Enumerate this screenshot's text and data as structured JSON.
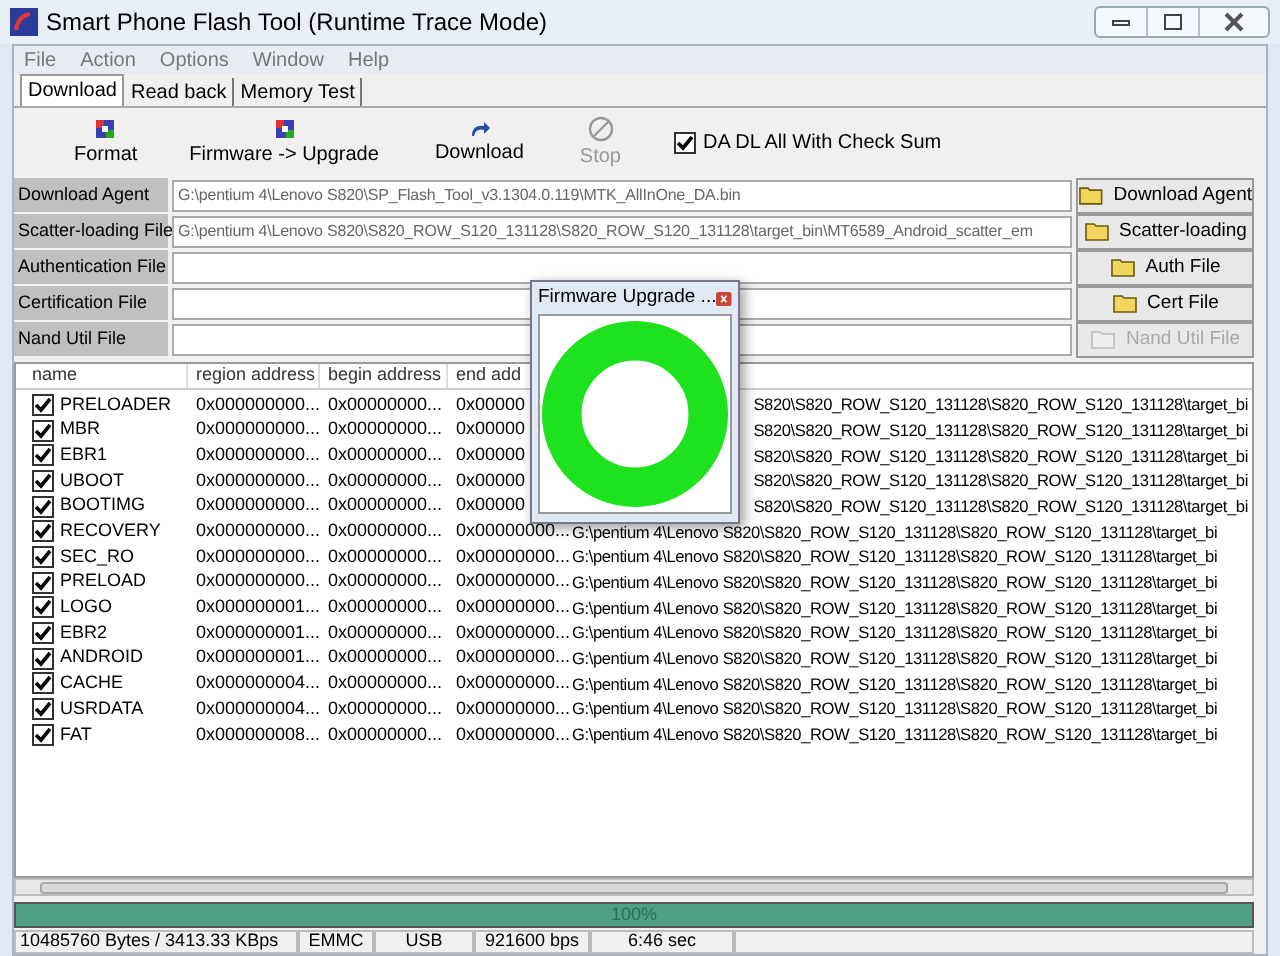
{
  "window": {
    "title": "Smart Phone Flash Tool (Runtime Trace Mode)"
  },
  "menu": [
    "File",
    "Action",
    "Options",
    "Window",
    "Help"
  ],
  "tabs": [
    {
      "label": "Download",
      "selected": true
    },
    {
      "label": "Read back",
      "selected": false
    },
    {
      "label": "Memory Test",
      "selected": false
    }
  ],
  "toolbar": [
    {
      "label": "Format",
      "kind": "format",
      "disabled": false
    },
    {
      "label": "Firmware -> Upgrade",
      "kind": "upgrade",
      "disabled": false
    },
    {
      "label": "Download",
      "kind": "download",
      "disabled": false
    },
    {
      "label": "Stop",
      "kind": "stop",
      "disabled": true
    }
  ],
  "checksum": {
    "label": "DA DL All With Check Sum",
    "checked": true
  },
  "files": [
    {
      "label": "Download Agent",
      "value": "G:\\pentium 4\\Lenovo S820\\SP_Flash_Tool_v3.1304.0.119\\MTK_AllInOne_DA.bin",
      "button": "Download Agent",
      "disabled": false
    },
    {
      "label": "Scatter-loading File",
      "value": "G:\\pentium 4\\Lenovo S820\\S820_ROW_S120_131128\\S820_ROW_S120_131128\\target_bin\\MT6589_Android_scatter_em",
      "button": "Scatter-loading",
      "disabled": false
    },
    {
      "label": "Authentication File",
      "button": "Auth File",
      "disabled": false
    },
    {
      "label": "Certification File",
      "button": "Cert File",
      "disabled": false
    },
    {
      "label": "Nand Util File",
      "button": "Nand Util File",
      "disabled": true
    }
  ],
  "table": {
    "columns": [
      "name",
      "region address",
      "begin address",
      "end add"
    ],
    "rows": [
      {
        "name": "PRELOADER",
        "checked": true,
        "region": "0x000000000...",
        "begin": "0x00000000...",
        "end": "0x00000",
        "location": "S820\\S820_ROW_S120_131128\\S820_ROW_S120_131128\\target_bi"
      },
      {
        "name": "MBR",
        "checked": true,
        "region": "0x000000000...",
        "begin": "0x00000000...",
        "end": "0x00000",
        "location": "S820\\S820_ROW_S120_131128\\S820_ROW_S120_131128\\target_bi"
      },
      {
        "name": "EBR1",
        "checked": true,
        "region": "0x000000000...",
        "begin": "0x00000000...",
        "end": "0x00000",
        "location": "S820\\S820_ROW_S120_131128\\S820_ROW_S120_131128\\target_bi"
      },
      {
        "name": "UBOOT",
        "checked": true,
        "region": "0x000000000...",
        "begin": "0x00000000...",
        "end": "0x00000",
        "location": "S820\\S820_ROW_S120_131128\\S820_ROW_S120_131128\\target_bi"
      },
      {
        "name": "BOOTIMG",
        "checked": true,
        "region": "0x000000000...",
        "begin": "0x00000000...",
        "end": "0x00000",
        "location": "S820\\S820_ROW_S120_131128\\S820_ROW_S120_131128\\target_bi"
      },
      {
        "name": "RECOVERY",
        "checked": true,
        "region": "0x000000000...",
        "begin": "0x00000000...",
        "end": "0x00000000...",
        "location": "G:\\pentium 4\\Lenovo S820\\S820_ROW_S120_131128\\S820_ROW_S120_131128\\target_bi"
      },
      {
        "name": "SEC_RO",
        "checked": true,
        "region": "0x000000000...",
        "begin": "0x00000000...",
        "end": "0x00000000...",
        "location": "G:\\pentium 4\\Lenovo S820\\S820_ROW_S120_131128\\S820_ROW_S120_131128\\target_bi"
      },
      {
        "name": "PRELOAD",
        "checked": true,
        "region": "0x000000000...",
        "begin": "0x00000000...",
        "end": "0x00000000...",
        "location": "G:\\pentium 4\\Lenovo S820\\S820_ROW_S120_131128\\S820_ROW_S120_131128\\target_bi"
      },
      {
        "name": "LOGO",
        "checked": true,
        "region": "0x000000001...",
        "begin": "0x00000000...",
        "end": "0x00000000...",
        "location": "G:\\pentium 4\\Lenovo S820\\S820_ROW_S120_131128\\S820_ROW_S120_131128\\target_bi"
      },
      {
        "name": "EBR2",
        "checked": true,
        "region": "0x000000001...",
        "begin": "0x00000000...",
        "end": "0x00000000...",
        "location": "G:\\pentium 4\\Lenovo S820\\S820_ROW_S120_131128\\S820_ROW_S120_131128\\target_bi"
      },
      {
        "name": "ANDROID",
        "checked": true,
        "region": "0x000000001...",
        "begin": "0x00000000...",
        "end": "0x00000000...",
        "location": "G:\\pentium 4\\Lenovo S820\\S820_ROW_S120_131128\\S820_ROW_S120_131128\\target_bi"
      },
      {
        "name": "CACHE",
        "checked": true,
        "region": "0x000000004...",
        "begin": "0x00000000...",
        "end": "0x00000000...",
        "location": "G:\\pentium 4\\Lenovo S820\\S820_ROW_S120_131128\\S820_ROW_S120_131128\\target_bi"
      },
      {
        "name": "USRDATA",
        "checked": true,
        "region": "0x000000004...",
        "begin": "0x00000000...",
        "end": "0x00000000...",
        "location": "G:\\pentium 4\\Lenovo S820\\S820_ROW_S120_131128\\S820_ROW_S120_131128\\target_bi"
      },
      {
        "name": "FAT",
        "checked": true,
        "region": "0x000000008...",
        "begin": "0x00000000...",
        "end": "0x00000000...",
        "location": "G:\\pentium 4\\Lenovo S820\\S820_ROW_S120_131128\\S820_ROW_S120_131128\\target_bi"
      }
    ]
  },
  "progress": {
    "level": 1,
    "text": "100%"
  },
  "status_bar": [
    "10485760 Bytes / 3413.33 KBps",
    "EMMC",
    "USB",
    "921600 bps",
    "6:46 sec"
  ],
  "dialog": {
    "title": "Firmware Upgrade ..."
  }
}
